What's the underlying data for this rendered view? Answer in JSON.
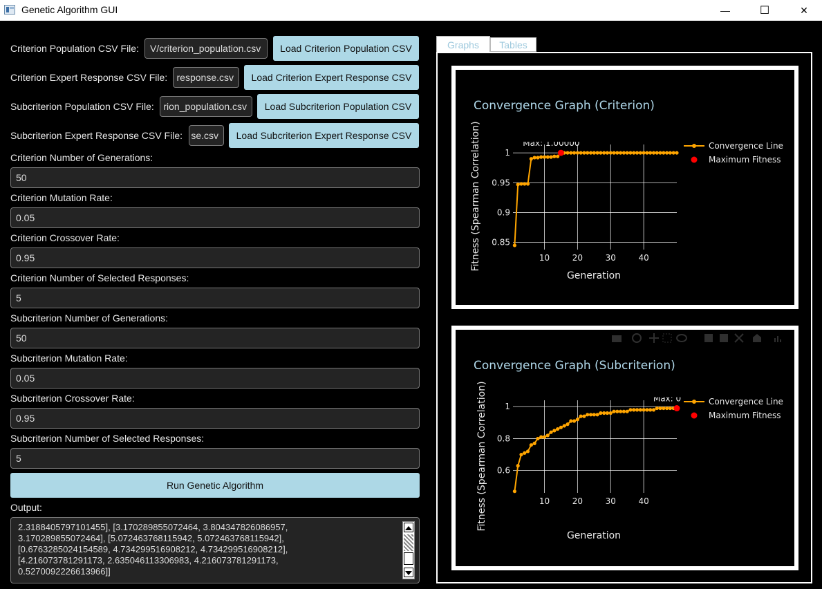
{
  "window": {
    "title": "Genetic Algorithm GUI",
    "minimize": "—",
    "maximize": "☐",
    "close": "✕"
  },
  "files": [
    {
      "label": "Criterion Population CSV File:",
      "value": "V/criterion_population.csv",
      "button": "Load Criterion Population CSV"
    },
    {
      "label": "Criterion Expert Response CSV File:",
      "value": "response.csv",
      "button": "Load Criterion Expert Response CSV"
    },
    {
      "label": "Subcriterion Population CSV File:",
      "value": "rion_population.csv",
      "button": "Load Subcriterion Population CSV"
    },
    {
      "label": "Subcriterion Expert Response CSV File:",
      "value": "se.csv",
      "button": "Load Subcriterion Expert Response CSV"
    }
  ],
  "params": [
    {
      "label": "Criterion Number of Generations:",
      "value": "50"
    },
    {
      "label": "Criterion Mutation Rate:",
      "value": "0.05"
    },
    {
      "label": "Criterion Crossover Rate:",
      "value": "0.95"
    },
    {
      "label": "Criterion Number of Selected Responses:",
      "value": "5"
    },
    {
      "label": "Subcriterion Number of Generations:",
      "value": "50"
    },
    {
      "label": "Subcriterion Mutation Rate:",
      "value": "0.05"
    },
    {
      "label": "Subcriterion Crossover Rate:",
      "value": "0.95"
    },
    {
      "label": "Subcriterion Number of Selected Responses:",
      "value": "5"
    }
  ],
  "run_button": "Run Genetic Algorithm",
  "output": {
    "label": "Output:",
    "lines": [
      "2.3188405797101455], [3.170289855072464, 3.804347826086957,",
      "3.170289855072464], [5.072463768115942, 5.072463768115942],",
      "[0.6763285024154589, 4.734299516908212, 4.734299516908212],",
      "[4.216073781291173, 2.635046113306983, 4.216073781291173,",
      "0.5270092226613966]]"
    ]
  },
  "tabs": {
    "graphs": "Graphs",
    "tables": "Tables"
  },
  "colors": {
    "line": "#FFA500",
    "max_marker": "#FF0000",
    "title": "#B0D8EA",
    "button": "#ADD8E6"
  },
  "chart_data": [
    {
      "type": "line",
      "title": "Convergence Graph (Criterion)",
      "xlabel": "Generation",
      "ylabel": "Fitness (Spearman Correlation)",
      "xlim": [
        0.5,
        50
      ],
      "ylim": [
        0.838,
        1.014
      ],
      "xticks": [
        10,
        20,
        30,
        40
      ],
      "yticks": [
        0.85,
        0.9,
        0.95,
        1
      ],
      "ytick_labels": [
        "0.85",
        "0.9",
        "0.95",
        "1"
      ],
      "grid": true,
      "legend_position": "top-right",
      "legend": [
        "Convergence Line",
        "Maximum Fitness"
      ],
      "series": [
        {
          "name": "Convergence Line",
          "x": [
            1,
            2,
            3,
            4,
            5,
            6,
            7,
            8,
            9,
            10,
            11,
            12,
            13,
            14,
            15,
            16,
            17,
            18,
            19,
            20,
            21,
            22,
            23,
            24,
            25,
            26,
            27,
            28,
            29,
            30,
            31,
            32,
            33,
            34,
            35,
            36,
            37,
            38,
            39,
            40,
            41,
            42,
            43,
            44,
            45,
            46,
            47,
            48,
            49,
            50
          ],
          "values": [
            0.845,
            0.947,
            0.948,
            0.948,
            0.948,
            0.99,
            0.992,
            0.992,
            0.993,
            0.993,
            0.993,
            0.993,
            0.994,
            0.994,
            1,
            1,
            1,
            1,
            1,
            1,
            1,
            1,
            1,
            1,
            1,
            1,
            1,
            1,
            1,
            1,
            1,
            1,
            1,
            1,
            1,
            1,
            1,
            1,
            1,
            1,
            1,
            1,
            1,
            1,
            1,
            1,
            1,
            1,
            1,
            1
          ]
        }
      ],
      "max_point": {
        "x": 15,
        "y": 1.0,
        "label": "Max: 1.00000"
      }
    },
    {
      "type": "line",
      "title": "Convergence Graph (Subcriterion)",
      "xlabel": "Generation",
      "ylabel": "Fitness (Spearman Correlation)",
      "xlim": [
        0.5,
        50
      ],
      "ylim": [
        0.46,
        1.04
      ],
      "xticks": [
        10,
        20,
        30,
        40
      ],
      "yticks": [
        0.6,
        0.8,
        1
      ],
      "ytick_labels": [
        "0.6",
        "0.8",
        "1"
      ],
      "grid": true,
      "legend_position": "top-right",
      "legend": [
        "Convergence Line",
        "Maximum Fitness"
      ],
      "series": [
        {
          "name": "Convergence Line",
          "x": [
            1,
            2,
            3,
            4,
            5,
            6,
            7,
            8,
            9,
            10,
            11,
            12,
            13,
            14,
            15,
            16,
            17,
            18,
            19,
            20,
            21,
            22,
            23,
            24,
            25,
            26,
            27,
            28,
            29,
            30,
            31,
            32,
            33,
            34,
            35,
            36,
            37,
            38,
            39,
            40,
            41,
            42,
            43,
            44,
            45,
            46,
            47,
            48,
            49,
            50
          ],
          "values": [
            0.47,
            0.63,
            0.7,
            0.71,
            0.72,
            0.76,
            0.77,
            0.8,
            0.81,
            0.81,
            0.82,
            0.84,
            0.85,
            0.86,
            0.87,
            0.88,
            0.89,
            0.91,
            0.91,
            0.92,
            0.94,
            0.94,
            0.95,
            0.95,
            0.95,
            0.95,
            0.96,
            0.96,
            0.96,
            0.96,
            0.97,
            0.97,
            0.97,
            0.97,
            0.97,
            0.98,
            0.98,
            0.98,
            0.98,
            0.98,
            0.98,
            0.98,
            0.98,
            0.99,
            0.99,
            0.99,
            0.99,
            0.99,
            0.99,
            0.99
          ]
        }
      ],
      "max_point": {
        "x": 50,
        "y": 0.99,
        "label": "Max: 0"
      }
    }
  ]
}
